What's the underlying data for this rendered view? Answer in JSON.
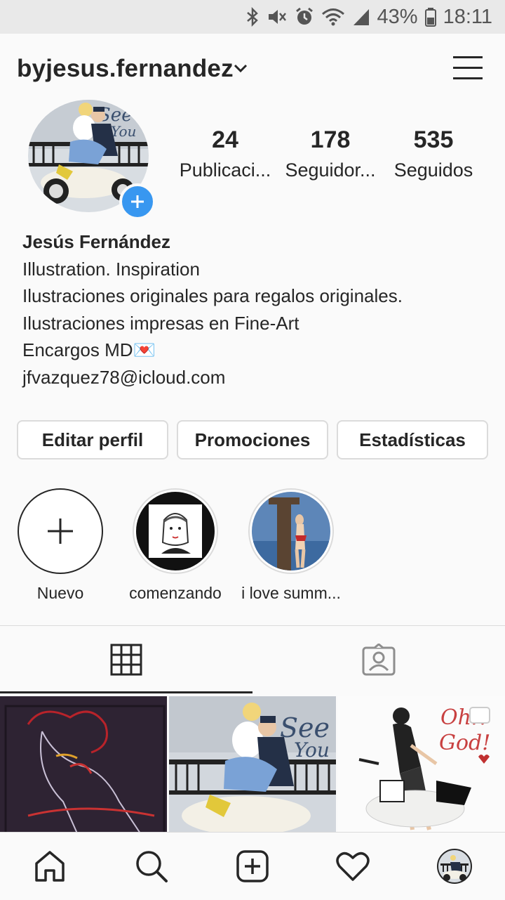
{
  "status_bar": {
    "battery": "43%",
    "time": "18:11",
    "icons": [
      "bluetooth-icon",
      "mute-icon",
      "alarm-icon",
      "wifi-icon",
      "signal-icon",
      "battery-icon"
    ]
  },
  "header": {
    "username": "byjesus.fernandez",
    "icons": [
      "chevron-down-icon",
      "menu-icon"
    ]
  },
  "stats": [
    {
      "value": "24",
      "label": "Publicaci..."
    },
    {
      "value": "178",
      "label": "Seguidor..."
    },
    {
      "value": "535",
      "label": "Seguidos"
    }
  ],
  "bio": {
    "name": "Jesús Fernández",
    "line1": "Illustration. Inspiration",
    "line2": "Ilustraciones originales para regalos originales.",
    "line3": "Ilustraciones impresas en Fine-Art",
    "line4": "Encargos MD💌",
    "email": "jfvazquez78@icloud.com"
  },
  "actions": {
    "edit": "Editar perfil",
    "promotions": "Promociones",
    "stats": "Estadísticas"
  },
  "highlights": [
    {
      "label": "Nuevo"
    },
    {
      "label": "comenzando"
    },
    {
      "label": "i love summ..."
    }
  ],
  "tabs": [
    "grid-icon",
    "tagged-icon"
  ],
  "bottom_nav": [
    "home-icon",
    "search-icon",
    "add-post-icon",
    "heart-icon",
    "profile-avatar"
  ],
  "colors": {
    "accent": "#3897f0",
    "text": "#262626",
    "border": "#dbdbdb",
    "background": "#fafafa"
  }
}
